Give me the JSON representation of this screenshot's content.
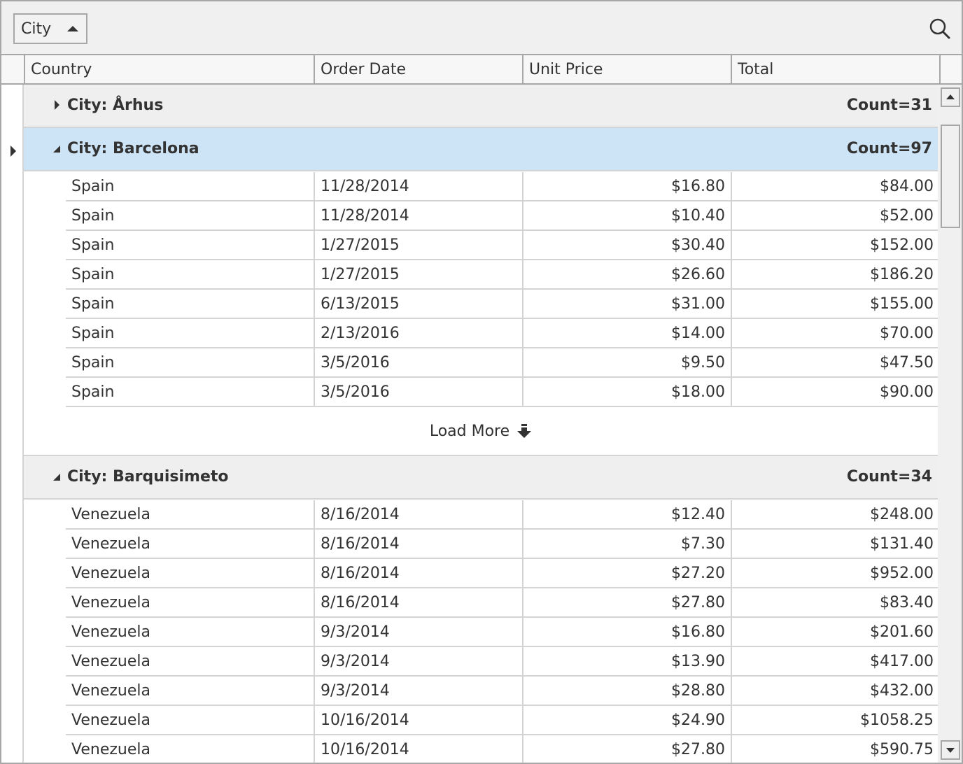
{
  "group_panel": {
    "group_by_label": "City",
    "sort_direction": "ascending",
    "search_icon": "search-icon"
  },
  "columns": [
    "Country",
    "Order Date",
    "Unit Price",
    "Total"
  ],
  "groups": [
    {
      "title": "City: Århus",
      "count": "Count=31",
      "expanded": false,
      "selected": false,
      "rows": []
    },
    {
      "title": "City: Barcelona",
      "count": "Count=97",
      "expanded": true,
      "selected": true,
      "rows": [
        [
          "Spain",
          "11/28/2014",
          "$16.80",
          "$84.00"
        ],
        [
          "Spain",
          "11/28/2014",
          "$10.40",
          "$52.00"
        ],
        [
          "Spain",
          "1/27/2015",
          "$30.40",
          "$152.00"
        ],
        [
          "Spain",
          "1/27/2015",
          "$26.60",
          "$186.20"
        ],
        [
          "Spain",
          "6/13/2015",
          "$31.00",
          "$155.00"
        ],
        [
          "Spain",
          "2/13/2016",
          "$14.00",
          "$70.00"
        ],
        [
          "Spain",
          "3/5/2016",
          "$9.50",
          "$47.50"
        ],
        [
          "Spain",
          "3/5/2016",
          "$18.00",
          "$90.00"
        ]
      ],
      "load_more_label": "Load More"
    },
    {
      "title": "City: Barquisimeto",
      "count": "Count=34",
      "expanded": true,
      "selected": false,
      "rows": [
        [
          "Venezuela",
          "8/16/2014",
          "$12.40",
          "$248.00"
        ],
        [
          "Venezuela",
          "8/16/2014",
          "$7.30",
          "$131.40"
        ],
        [
          "Venezuela",
          "8/16/2014",
          "$27.20",
          "$952.00"
        ],
        [
          "Venezuela",
          "8/16/2014",
          "$27.80",
          "$83.40"
        ],
        [
          "Venezuela",
          "9/3/2014",
          "$16.80",
          "$201.60"
        ],
        [
          "Venezuela",
          "9/3/2014",
          "$13.90",
          "$417.00"
        ],
        [
          "Venezuela",
          "9/3/2014",
          "$28.80",
          "$432.00"
        ],
        [
          "Venezuela",
          "10/16/2014",
          "$24.90",
          "$1058.25"
        ],
        [
          "Venezuela",
          "10/16/2014",
          "$27.80",
          "$590.75"
        ]
      ]
    }
  ]
}
